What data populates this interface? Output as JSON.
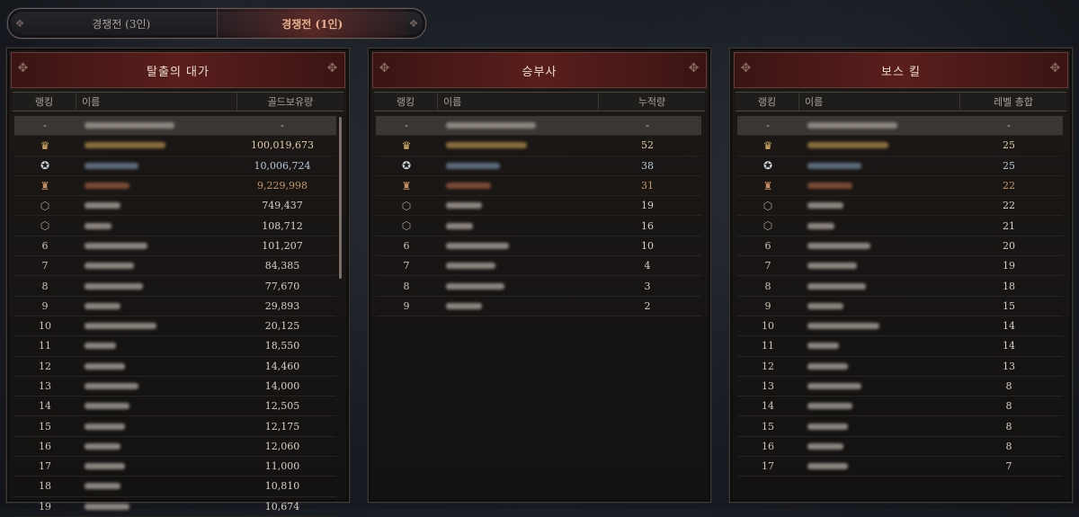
{
  "tabs": [
    {
      "label": "경쟁전 (3인)"
    },
    {
      "label": "경쟁전 (1인)"
    }
  ],
  "panels": [
    {
      "title": "탈출의 대가",
      "columns": {
        "rank": "랭킹",
        "name": "이름",
        "value": "골드보유량"
      },
      "me_row": {
        "rank": "-",
        "value": "-"
      },
      "rows": [
        {
          "rank": "1",
          "value": "100,019,673",
          "tier": "gold"
        },
        {
          "rank": "2",
          "value": "10,006,724",
          "tier": "silver"
        },
        {
          "rank": "3",
          "value": "9,229,998",
          "tier": "bronze"
        },
        {
          "rank": "4",
          "value": "749,437",
          "tier": "plain"
        },
        {
          "rank": "5",
          "value": "108,712",
          "tier": "plain"
        },
        {
          "rank": "6",
          "value": "101,207"
        },
        {
          "rank": "7",
          "value": "84,385"
        },
        {
          "rank": "8",
          "value": "77,670"
        },
        {
          "rank": "9",
          "value": "29,893"
        },
        {
          "rank": "10",
          "value": "20,125"
        },
        {
          "rank": "11",
          "value": "18,550"
        },
        {
          "rank": "12",
          "value": "14,460"
        },
        {
          "rank": "13",
          "value": "14,000"
        },
        {
          "rank": "14",
          "value": "12,505"
        },
        {
          "rank": "15",
          "value": "12,175"
        },
        {
          "rank": "16",
          "value": "12,060"
        },
        {
          "rank": "17",
          "value": "11,000"
        },
        {
          "rank": "18",
          "value": "10,810"
        },
        {
          "rank": "19",
          "value": "10,674"
        }
      ]
    },
    {
      "title": "승부사",
      "columns": {
        "rank": "랭킹",
        "name": "이름",
        "value": "누적량"
      },
      "me_row": {
        "rank": "-",
        "value": "-"
      },
      "rows": [
        {
          "rank": "1",
          "value": "52",
          "tier": "gold"
        },
        {
          "rank": "2",
          "value": "38",
          "tier": "silver"
        },
        {
          "rank": "3",
          "value": "31",
          "tier": "bronze"
        },
        {
          "rank": "4",
          "value": "19",
          "tier": "plain"
        },
        {
          "rank": "5",
          "value": "16",
          "tier": "plain"
        },
        {
          "rank": "6",
          "value": "10"
        },
        {
          "rank": "7",
          "value": "4"
        },
        {
          "rank": "8",
          "value": "3"
        },
        {
          "rank": "9",
          "value": "2"
        }
      ]
    },
    {
      "title": "보스 킬",
      "columns": {
        "rank": "랭킹",
        "name": "이름",
        "value": "레벨 총합"
      },
      "me_row": {
        "rank": "-",
        "value": "-"
      },
      "rows": [
        {
          "rank": "1",
          "value": "25",
          "tier": "gold"
        },
        {
          "rank": "2",
          "value": "25",
          "tier": "silver"
        },
        {
          "rank": "3",
          "value": "22",
          "tier": "bronze"
        },
        {
          "rank": "4",
          "value": "22",
          "tier": "plain"
        },
        {
          "rank": "5",
          "value": "21",
          "tier": "plain"
        },
        {
          "rank": "6",
          "value": "20"
        },
        {
          "rank": "7",
          "value": "19"
        },
        {
          "rank": "8",
          "value": "18"
        },
        {
          "rank": "9",
          "value": "15"
        },
        {
          "rank": "10",
          "value": "14"
        },
        {
          "rank": "11",
          "value": "14"
        },
        {
          "rank": "12",
          "value": "13"
        },
        {
          "rank": "13",
          "value": "8"
        },
        {
          "rank": "14",
          "value": "8"
        },
        {
          "rank": "15",
          "value": "8"
        },
        {
          "rank": "16",
          "value": "8"
        },
        {
          "rank": "17",
          "value": "7"
        }
      ]
    }
  ],
  "icons": {
    "gold": "crown-medal-icon",
    "silver": "star-medal-icon",
    "bronze": "shield-medal-icon",
    "plain": "badge-medal-icon"
  },
  "colors": {
    "accent": "#5a1e1c",
    "active_tab_text": "#e8b18c"
  }
}
